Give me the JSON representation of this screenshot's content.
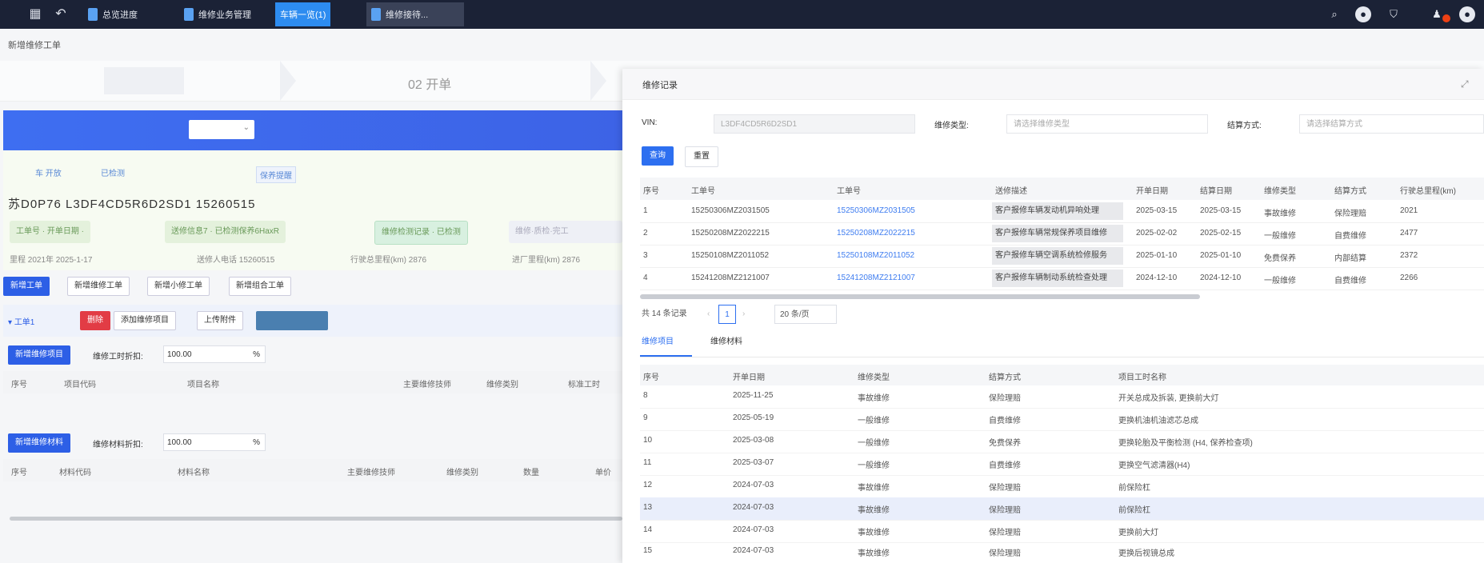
{
  "topbar": {
    "tabs": [
      {
        "label": "总览进度"
      },
      {
        "label": "维修业务管理"
      },
      {
        "label": "车辆一览(1)"
      },
      {
        "label": "维修接待..."
      }
    ],
    "icons": [
      "grid-icon",
      "back-icon",
      "search-icon",
      "user-circle-icon",
      "shield-icon",
      "bell-icon",
      "account-icon"
    ]
  },
  "breadcrumb": "新增维修工单",
  "steps": {
    "step2": "02 开单"
  },
  "left": {
    "tags": [
      "车 开放",
      "已检测",
      "保养提醒"
    ],
    "vin_line": "苏D0P76  L3DF4CD5R6D2SD1  15260515",
    "chips": [
      "工单号 ·  开单日期 ·",
      "送修信息7 · 已检测保养6HaxR",
      "维修检测记录 · 已检测",
      "维修·质检·完工"
    ],
    "info": [
      "里程 2021年 2025-1-17",
      "送修人电话 15260515",
      "行驶总里程(km) 2876",
      "进厂里程(km) 2876"
    ],
    "buttons": [
      "新增工单",
      "新增维修工单",
      "新增小修工单",
      "新增组合工单"
    ],
    "section": {
      "title": "工单1",
      "delete": "删除",
      "add_item": "添加维修项目",
      "upload": "上传附件"
    },
    "block1": {
      "button": "新增维修项目",
      "label": "维修工时折扣:",
      "value": "100.00",
      "unit": "%"
    },
    "table1_headers": [
      "序号",
      "项目代码",
      "项目名称",
      "主要维修技师",
      "维修类别",
      "标准工时"
    ],
    "block2": {
      "button": "新增维修材料",
      "label": "维修材料折扣:",
      "value": "100.00",
      "unit": "%"
    },
    "table2_headers": [
      "序号",
      "材料代码",
      "材料名称",
      "主要维修技师",
      "维修类别",
      "数量",
      "单价"
    ]
  },
  "panel": {
    "title": "维修记录",
    "filters": [
      {
        "label": "VIN:",
        "placeholder": "L3DF4CD5R6D2SD1"
      },
      {
        "label": "维修类型:",
        "placeholder": "请选择维修类型"
      },
      {
        "label": "结算方式:",
        "placeholder": "请选择结算方式"
      }
    ],
    "search_btn": "查询",
    "reset_btn": "重置",
    "table1": {
      "headers": [
        "序号",
        "工单号",
        "工单号",
        "送修描述",
        "开单日期",
        "结算日期",
        "维修类型",
        "结算方式",
        "行驶总里程(km)"
      ],
      "rows": [
        [
          "1",
          "15250306MZ2031505",
          "15250306MZ2031505",
          "客户报修车辆发动机异响处理",
          "2025-03-15",
          "2025-03-15",
          "事故维修",
          "保险理赔",
          "2021"
        ],
        [
          "2",
          "15250208MZ2022215",
          "15250208MZ2022215",
          "客户报修车辆常规保养项目维修",
          "2025-02-02",
          "2025-02-15",
          "一般维修",
          "自费维修",
          "2477"
        ],
        [
          "3",
          "15250108MZ2011052",
          "15250108MZ2011052",
          "客户报修车辆空调系统检修服务",
          "2025-01-10",
          "2025-01-10",
          "免费保养",
          "内部结算",
          "2372"
        ],
        [
          "4",
          "15241208MZ2121007",
          "15241208MZ2121007",
          "客户报修车辆制动系统检查处理",
          "2024-12-10",
          "2024-12-10",
          "一般维修",
          "自费维修",
          "2266"
        ]
      ]
    },
    "pager": {
      "total": "共 14 条记录",
      "page": "1",
      "size": "20 条/页"
    },
    "subtabs": [
      "维修项目",
      "维修材料"
    ],
    "table2": {
      "headers": [
        "序号",
        "开单日期",
        "维修类型",
        "结算方式",
        "项目工时名称"
      ],
      "rows": [
        [
          "8",
          "2025-11-25",
          "事故维修",
          "保险理赔",
          "开关总成及拆装, 更换前大灯"
        ],
        [
          "9",
          "2025-05-19",
          "一般维修",
          "自费维修",
          "更换机油机油滤芯总成"
        ],
        [
          "10",
          "2025-03-08",
          "一般维修",
          "免费保养",
          "更换轮胎及平衡检测 (H4, 保养检查项)"
        ],
        [
          "11",
          "2025-03-07",
          "一般维修",
          "自费维修",
          "更换空气滤清器(H4)"
        ],
        [
          "12",
          "2024-07-03",
          "事故维修",
          "保险理赔",
          "前保险杠"
        ],
        [
          "13",
          "2024-07-03",
          "事故维修",
          "保险理赔",
          "前保险杠"
        ],
        [
          "14",
          "2024-07-03",
          "事故维修",
          "保险理赔",
          "更换前大灯"
        ],
        [
          "15",
          "2024-07-03",
          "事故维修",
          "保险理赔",
          "更换后视镜总成"
        ]
      ]
    }
  }
}
